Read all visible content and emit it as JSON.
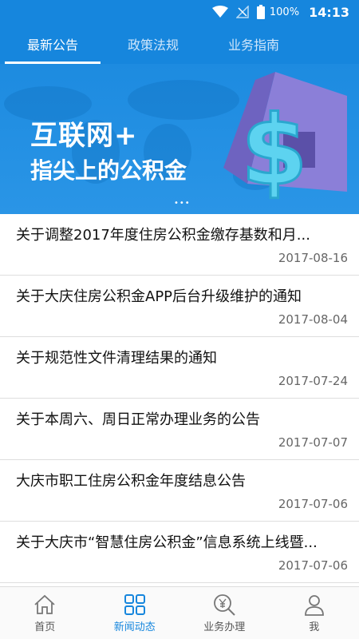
{
  "status_bar": {
    "battery": "100%",
    "time": "14:13"
  },
  "tabs": [
    {
      "label": "最新公告",
      "active": true
    },
    {
      "label": "政策法规",
      "active": false
    },
    {
      "label": "业务指南",
      "active": false
    }
  ],
  "banner": {
    "line1": "互联网+",
    "line2": "指尖上的公积金",
    "dots": "•••"
  },
  "news": [
    {
      "title": "关于调整2017年度住房公积金缴存基数和月...",
      "date": "2017-08-16"
    },
    {
      "title": "关于大庆住房公积金APP后台升级维护的通知",
      "date": "2017-08-04"
    },
    {
      "title": "关于规范性文件清理结果的通知",
      "date": "2017-07-24"
    },
    {
      "title": "关于本周六、周日正常办理业务的公告",
      "date": "2017-07-07"
    },
    {
      "title": "大庆市职工住房公积金年度结息公告",
      "date": "2017-07-06"
    },
    {
      "title": "关于大庆市“智慧住房公积金”信息系统上线暨...",
      "date": "2017-07-06"
    }
  ],
  "bottom_nav": [
    {
      "label": "首页",
      "icon": "home-icon",
      "active": false
    },
    {
      "label": "新闻动态",
      "icon": "news-grid-icon",
      "active": true
    },
    {
      "label": "业务办理",
      "icon": "yen-search-icon",
      "active": false
    },
    {
      "label": "我",
      "icon": "user-icon",
      "active": false
    }
  ],
  "colors": {
    "primary": "#1686dd",
    "banner": "#2a95e6",
    "divider": "#dedede"
  }
}
